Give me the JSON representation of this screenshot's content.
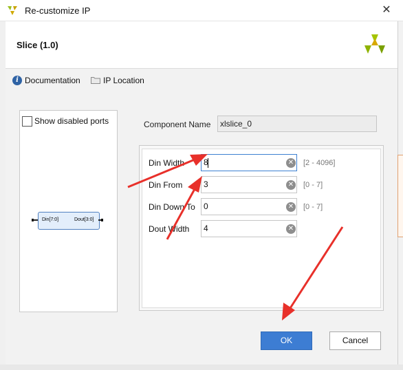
{
  "window": {
    "title": "Re-customize IP",
    "close_symbol": "✕"
  },
  "header": {
    "title": "Slice (1.0)"
  },
  "toolbar": {
    "documentation_label": "Documentation",
    "ip_location_label": "IP Location"
  },
  "left_panel": {
    "show_disabled_ports_label": "Show disabled ports",
    "show_disabled_ports_checked": false,
    "block": {
      "input_port": "Din[7:0]",
      "output_port": "Dout[3:0]"
    }
  },
  "component": {
    "label": "Component Name",
    "value": "xlslice_0"
  },
  "params": [
    {
      "label": "Din Width",
      "value": "8",
      "range": "[2 - 4096]"
    },
    {
      "label": "Din From",
      "value": "3",
      "range": "[0 - 7]"
    },
    {
      "label": "Din Down To",
      "value": "0",
      "range": "[0 - 7]"
    },
    {
      "label": "Dout Width",
      "value": "4",
      "range": ""
    }
  ],
  "buttons": {
    "ok": "OK",
    "cancel": "Cancel"
  },
  "colors": {
    "accent": "#3d7dd3",
    "annotation_arrow": "#e8302a",
    "brand": "#9bbf1f"
  }
}
